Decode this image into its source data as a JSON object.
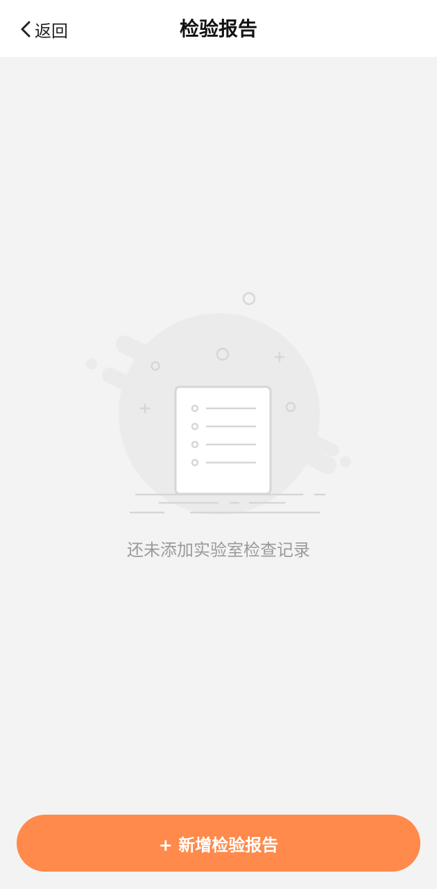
{
  "header": {
    "back_label": "返回",
    "title": "检验报告"
  },
  "empty_state": {
    "message": "还未添加实验室检查记录",
    "illustration_icon": "empty-report-icon"
  },
  "footer": {
    "add_button_label": "+ 新增检验报告"
  },
  "colors": {
    "accent": "#ff8a4b",
    "background": "#f3f3f3",
    "nav_background": "#ffffff",
    "muted_text": "#9a9a9a"
  }
}
